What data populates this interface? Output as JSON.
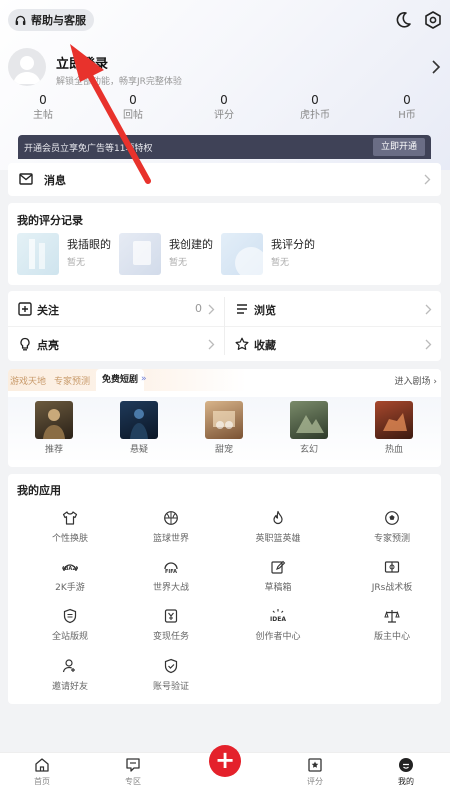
{
  "header": {
    "help_label": "帮助与客服"
  },
  "profile": {
    "login_title": "立即登录",
    "login_subtitle": "解锁全部功能，畅享JR完整体验"
  },
  "stats": [
    {
      "value": "0",
      "label": "主帖"
    },
    {
      "value": "0",
      "label": "回帖"
    },
    {
      "value": "0",
      "label": "评分"
    },
    {
      "value": "0",
      "label": "虎扑币"
    },
    {
      "value": "0",
      "label": "H币"
    }
  ],
  "vip": {
    "text": "开通会员立享免广告等11项特权",
    "button": "立即开通"
  },
  "messages": {
    "label": "消息"
  },
  "rating": {
    "title": "我的评分记录",
    "items": [
      {
        "name": "我插眼的",
        "sub": "暂无"
      },
      {
        "name": "我创建的",
        "sub": "暂无"
      },
      {
        "name": "我评分的",
        "sub": "暂无"
      }
    ]
  },
  "follow": {
    "follow_label": "关注",
    "follow_count": "0",
    "browse_label": "浏览",
    "like_label": "点亮",
    "collect_label": "收藏"
  },
  "shorts": {
    "tabs": [
      "游戏天地",
      "专家预测",
      "免费短剧"
    ],
    "enter_label": "进入剧场",
    "genres": [
      "推荐",
      "悬疑",
      "甜宠",
      "玄幻",
      "热血"
    ]
  },
  "apps": {
    "title": "我的应用",
    "items": [
      {
        "label": "个性换肤",
        "icon": "shirt-icon"
      },
      {
        "label": "篮球世界",
        "icon": "basketball-icon"
      },
      {
        "label": "英职篮英雄",
        "icon": "fire-icon"
      },
      {
        "label": "专家预测",
        "icon": "soccer-icon"
      },
      {
        "label": "2K手游",
        "icon": "2k-icon"
      },
      {
        "label": "世界大战",
        "icon": "fifa-icon"
      },
      {
        "label": "草稿箱",
        "icon": "edit-icon"
      },
      {
        "label": "JRs战术板",
        "icon": "tactics-board-icon"
      },
      {
        "label": "全站版规",
        "icon": "shield-icon"
      },
      {
        "label": "变现任务",
        "icon": "money-task-icon"
      },
      {
        "label": "创作者中心",
        "icon": "idea-icon"
      },
      {
        "label": "版主中心",
        "icon": "scale-icon"
      },
      {
        "label": "邀请好友",
        "icon": "add-user-icon"
      },
      {
        "label": "账号验证",
        "icon": "verify-shield-icon"
      }
    ]
  },
  "nav": {
    "items": [
      {
        "label": "首页",
        "icon": "home-icon"
      },
      {
        "label": "专区",
        "icon": "chat-icon"
      },
      {
        "label": "评分",
        "icon": "star-icon"
      },
      {
        "label": "我的",
        "icon": "profile-icon"
      }
    ],
    "plus": "+"
  },
  "colors": {
    "accent": "#e4212b",
    "vip_bg": "#3f4257"
  }
}
